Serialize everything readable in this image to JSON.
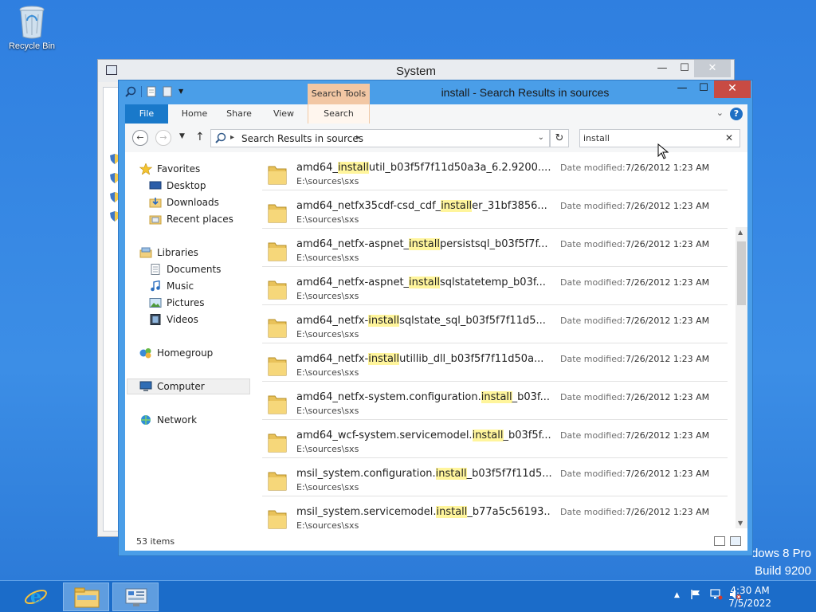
{
  "desktop": {
    "recycle_bin_label": "Recycle Bin",
    "watermark_line1": "dows 8 Pro",
    "watermark_line2": "Build 9200"
  },
  "system_window": {
    "title": "System"
  },
  "explorer": {
    "title": "install - Search Results in sources",
    "context_tab_group": "Search Tools",
    "ribbon_tabs": [
      "File",
      "Home",
      "Share",
      "View",
      "Search"
    ],
    "address": {
      "location": "Search Results in sources"
    },
    "search": {
      "value": "install"
    },
    "nav_pane": {
      "favorites": "Favorites",
      "desktop": "Desktop",
      "downloads": "Downloads",
      "recent_places": "Recent places",
      "libraries": "Libraries",
      "documents": "Documents",
      "music": "Music",
      "pictures": "Pictures",
      "videos": "Videos",
      "homegroup": "Homegroup",
      "computer": "Computer",
      "network": "Network"
    },
    "results": [
      {
        "pre": "amd64_",
        "hit": "install",
        "post": "util_b03f5f7f11d50a3a_6.2.9200....",
        "path": "E:\\sources\\sxs",
        "date_label": "Date modified:",
        "date": "7/26/2012 1:23 AM"
      },
      {
        "pre": "amd64_netfx35cdf-csd_cdf_",
        "hit": "install",
        "post": "er_31bf3856...",
        "path": "E:\\sources\\sxs",
        "date_label": "Date modified:",
        "date": "7/26/2012 1:23 AM"
      },
      {
        "pre": "amd64_netfx-aspnet_",
        "hit": "install",
        "post": "persistsql_b03f5f7f...",
        "path": "E:\\sources\\sxs",
        "date_label": "Date modified:",
        "date": "7/26/2012 1:23 AM"
      },
      {
        "pre": "amd64_netfx-aspnet_",
        "hit": "install",
        "post": "sqlstatetemp_b03f...",
        "path": "E:\\sources\\sxs",
        "date_label": "Date modified:",
        "date": "7/26/2012 1:23 AM"
      },
      {
        "pre": "amd64_netfx-",
        "hit": "install",
        "post": "sqlstate_sql_b03f5f7f11d5...",
        "path": "E:\\sources\\sxs",
        "date_label": "Date modified:",
        "date": "7/26/2012 1:23 AM"
      },
      {
        "pre": "amd64_netfx-",
        "hit": "install",
        "post": "utillib_dll_b03f5f7f11d50a...",
        "path": "E:\\sources\\sxs",
        "date_label": "Date modified:",
        "date": "7/26/2012 1:23 AM"
      },
      {
        "pre": "amd64_netfx-system.configuration.",
        "hit": "install",
        "post": "_b03f...",
        "path": "E:\\sources\\sxs",
        "date_label": "Date modified:",
        "date": "7/26/2012 1:23 AM"
      },
      {
        "pre": "amd64_wcf-system.servicemodel.",
        "hit": "install",
        "post": "_b03f5f...",
        "path": "E:\\sources\\sxs",
        "date_label": "Date modified:",
        "date": "7/26/2012 1:23 AM"
      },
      {
        "pre": "msil_system.configuration.",
        "hit": "install",
        "post": "_b03f5f7f11d5...",
        "path": "E:\\sources\\sxs",
        "date_label": "Date modified:",
        "date": "7/26/2012 1:23 AM"
      },
      {
        "pre": "msil_system.servicemodel.",
        "hit": "install",
        "post": "_b77a5c56193...",
        "path": "E:\\sources\\sxs",
        "date_label": "Date modified:",
        "date": "7/26/2012 1:23 AM"
      }
    ],
    "status": {
      "item_count": "53 items"
    }
  },
  "taskbar": {
    "time": "4:30 AM",
    "date": "7/5/2022"
  },
  "colors": {
    "accent": "#1979ca",
    "highlight": "#fff59c",
    "close_red": "#c84b43"
  }
}
